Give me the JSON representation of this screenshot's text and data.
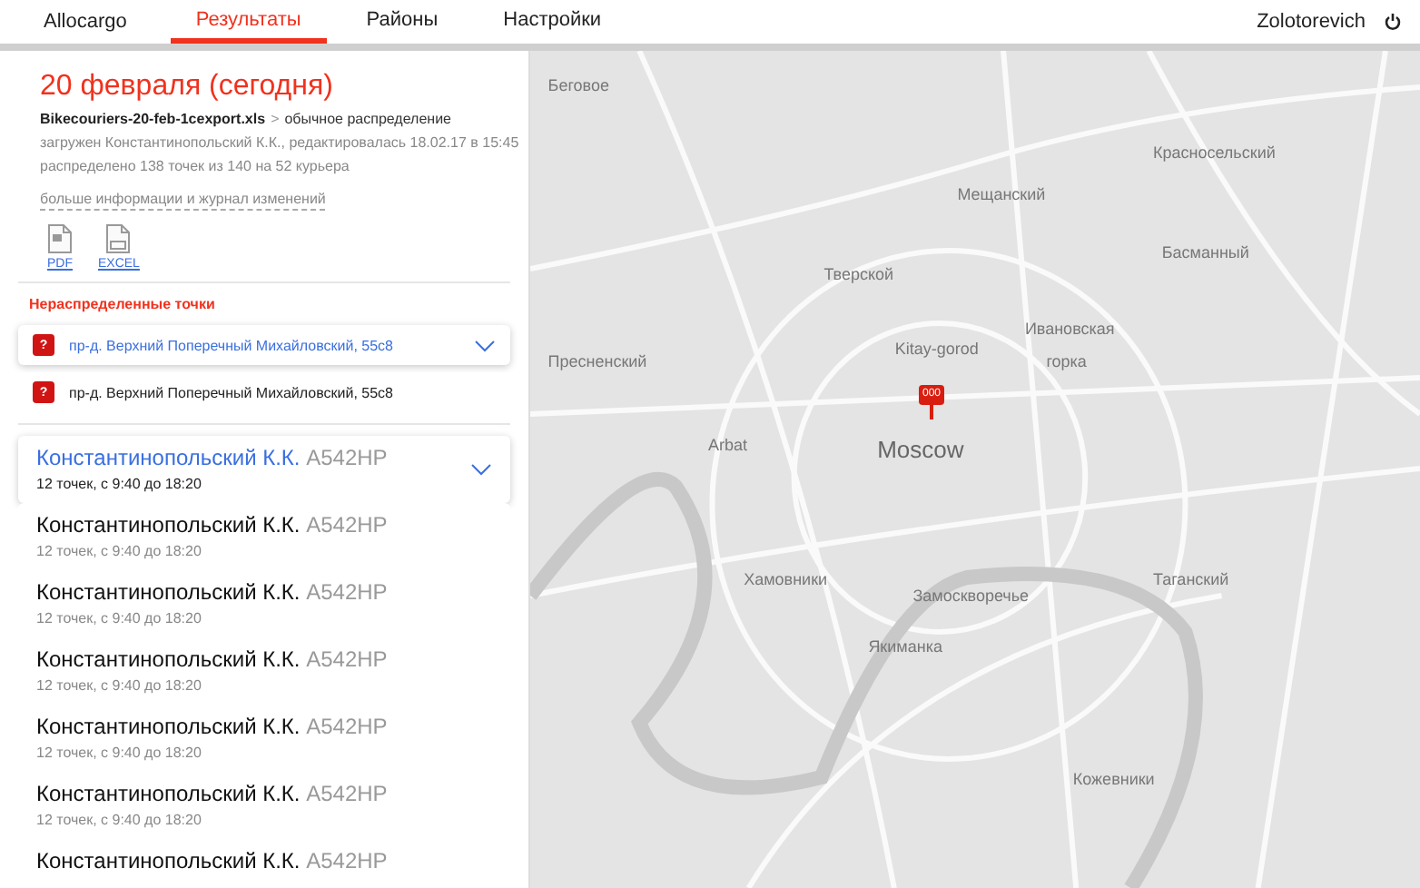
{
  "nav": {
    "brand": "Allocargo",
    "tabs": [
      {
        "label": "Результаты",
        "selected": true
      },
      {
        "label": "Районы",
        "selected": false
      },
      {
        "label": "Настройки",
        "selected": false
      }
    ],
    "user": "Zolotorevich"
  },
  "summary": {
    "title": "20 февраля (сегодня)",
    "file": "Bikecouriers-20-feb-1cexport.xls",
    "separator": ">",
    "mode": "обычное распределение",
    "uploaded": "загружен Константинопольский К.К., редактировалась 18.02.17 в 15:45",
    "distributed": "распределено 138 точек из 140 на 52 курьера",
    "more_link": "больше информации и журнал изменений",
    "exports": [
      {
        "kind": "pdf",
        "label": "PDF"
      },
      {
        "kind": "excel",
        "label": "EXCEL"
      }
    ]
  },
  "unassigned": {
    "heading": "Нераспределенные точки",
    "items": [
      {
        "badge": "?",
        "address": "пр-д. Верхний Поперечный Михайловский, 55с8",
        "expanded": true
      },
      {
        "badge": "?",
        "address": "пр-д. Верхний Поперечный Михайловский, 55с8",
        "expanded": false
      }
    ]
  },
  "couriers": [
    {
      "name": "Константинопольский К.К.",
      "plate": "А542НР",
      "details": "12 точек, с 9:40 до 18:20",
      "expanded": true
    },
    {
      "name": "Константинопольский К.К.",
      "plate": "А542НР",
      "details": "12 точек, с 9:40 до 18:20",
      "expanded": false
    },
    {
      "name": "Константинопольский К.К.",
      "plate": "А542НР",
      "details": "12 точек, с 9:40 до 18:20",
      "expanded": false
    },
    {
      "name": "Константинопольский К.К.",
      "plate": "А542НР",
      "details": "12 точек, с 9:40 до 18:20",
      "expanded": false
    },
    {
      "name": "Константинопольский К.К.",
      "plate": "А542НР",
      "details": "12 точек, с 9:40 до 18:20",
      "expanded": false
    },
    {
      "name": "Константинопольский К.К.",
      "plate": "А542НР",
      "details": "12 точек, с 9:40 до 18:20",
      "expanded": false
    },
    {
      "name": "Константинопольский К.К.",
      "plate": "А542НР",
      "expanded": false
    }
  ],
  "map": {
    "marker": "000",
    "labels": [
      {
        "text": "Беговое",
        "kind": "district"
      },
      {
        "text": "Красносельский",
        "kind": "district"
      },
      {
        "text": "Мещанский",
        "kind": "district"
      },
      {
        "text": "Басманный",
        "kind": "district"
      },
      {
        "text": "Тверской",
        "kind": "district"
      },
      {
        "text": "Ивановская",
        "kind": "district"
      },
      {
        "text": "Kitay-gorod",
        "kind": "district"
      },
      {
        "text": "Пресненский",
        "kind": "district"
      },
      {
        "text": "горка",
        "kind": "district"
      },
      {
        "text": "Arbat",
        "kind": "district"
      },
      {
        "text": "Moscow",
        "kind": "city"
      },
      {
        "text": "Хамовники",
        "kind": "district"
      },
      {
        "text": "Таганский",
        "kind": "district"
      },
      {
        "text": "Замоскворечье",
        "kind": "district"
      },
      {
        "text": "Якиманка",
        "kind": "district"
      },
      {
        "text": "Кожевники",
        "kind": "district"
      }
    ]
  }
}
